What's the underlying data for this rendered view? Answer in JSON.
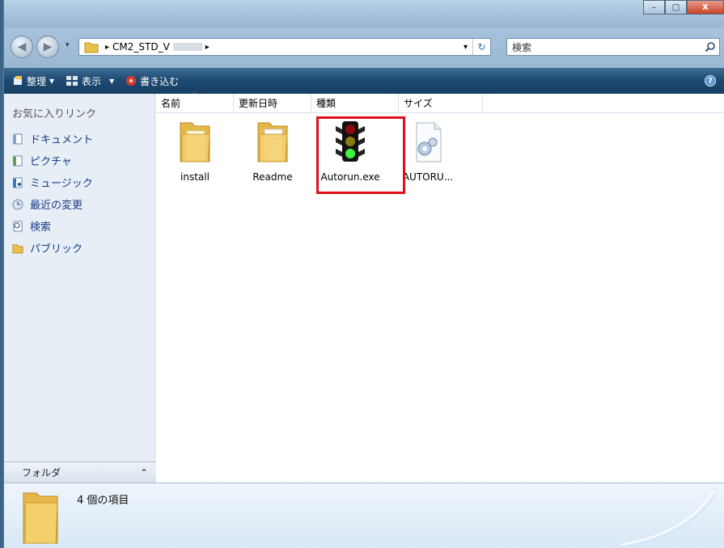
{
  "window": {
    "minimize": "–",
    "maximize": "□",
    "close": "X"
  },
  "address": {
    "sep1": "▸",
    "path": "CM2_STD_V",
    "sep2": "▸",
    "dropdown": "▾",
    "refresh": "↻",
    "search_placeholder": "検索",
    "search_icon": "magnifier"
  },
  "toolbar": {
    "organize": "整理",
    "view": "表示",
    "burn": "書き込む",
    "dropdown": "▾",
    "help": "?"
  },
  "sidebar": {
    "header": "お気に入りリンク",
    "items": [
      {
        "label": "ドキュメント",
        "icon": "documents-icon"
      },
      {
        "label": "ピクチャ",
        "icon": "pictures-icon"
      },
      {
        "label": "ミュージック",
        "icon": "music-icon"
      },
      {
        "label": "最近の変更",
        "icon": "recent-icon"
      },
      {
        "label": "検索",
        "icon": "search-icon"
      },
      {
        "label": "パブリック",
        "icon": "public-folder-icon"
      }
    ],
    "folders_label": "フォルダ",
    "folders_chevron": "⌃"
  },
  "columns": [
    "名前",
    "更新日時",
    "種類",
    "サイズ"
  ],
  "files": [
    {
      "name": "install",
      "icon": "folder-icon"
    },
    {
      "name": "Readme",
      "icon": "folder-icon"
    },
    {
      "name": "Autorun.exe",
      "icon": "traffic-light-icon"
    },
    {
      "name": "AUTORU...",
      "icon": "settings-file-icon"
    }
  ],
  "details": {
    "count": "4 個の項目"
  },
  "colors": {
    "highlight": "#e0101a",
    "toolbar": "#1e4a73",
    "link": "#1a3a8a"
  }
}
